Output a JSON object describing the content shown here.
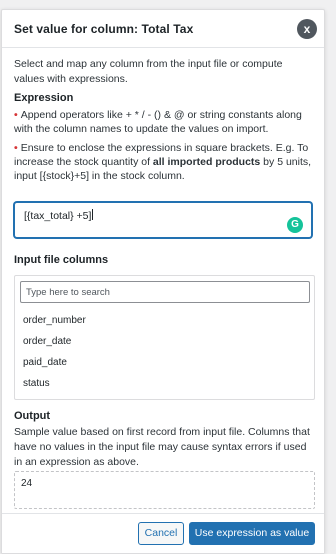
{
  "modal": {
    "title": "Set value for column: Total Tax",
    "close_glyph": "x",
    "description": "Select and map any column from the input file or compute values with expressions."
  },
  "expression": {
    "label": "Expression",
    "bullet1": "Append operators like + * / - () & @ or string constants along with the column names to update the values on import.",
    "bullet2_pre": "Ensure to enclose the expressions in square brackets. E.g. To increase the stock quantity of ",
    "bullet2_bold": "all imported products",
    "bullet2_post": " by 5 units, input [{stock}+5] in the stock column.",
    "value": "[{tax_total} +5]",
    "grammarly_glyph": "G"
  },
  "input_columns": {
    "label": "Input file columns",
    "search_placeholder": "Type here to search",
    "items": [
      "order_number",
      "order_date",
      "paid_date",
      "status"
    ]
  },
  "output": {
    "label": "Output",
    "description": "Sample value based on first record from input file. Columns that have no values in the input file may cause syntax errors if used in an expression as above.",
    "value": "24"
  },
  "footer": {
    "cancel_label": "Cancel",
    "submit_label": "Use expression as value"
  },
  "colors": {
    "accent": "#2271b1",
    "bullet_dot": "#d63638",
    "grammarly": "#15c39a",
    "close_button": "#50575e"
  }
}
